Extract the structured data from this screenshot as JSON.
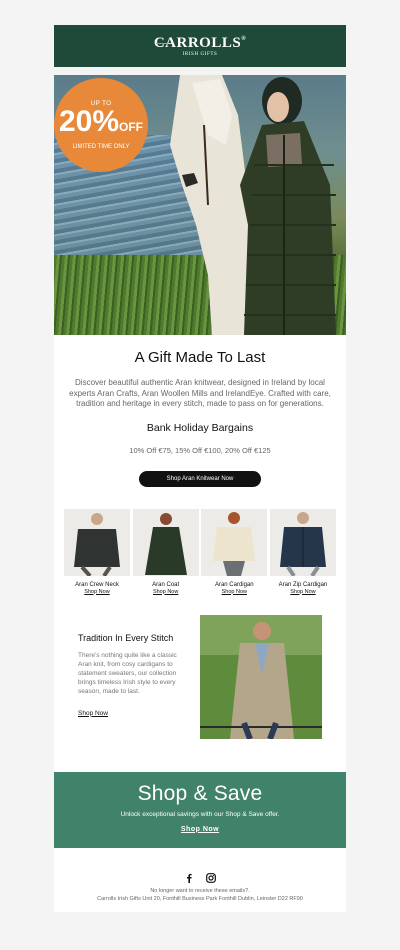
{
  "header": {
    "logo_main": "CARROLLS",
    "logo_reg": "®",
    "logo_sub": "IRISH GIFTS",
    "bg_color": "#1f4a3a"
  },
  "hero": {
    "badge_top": "UP TO",
    "badge_percent": "20%",
    "badge_off": "OFF",
    "badge_bottom": "LIMITED TIME ONLY",
    "badge_color": "#e8893a"
  },
  "intro": {
    "title": "A Gift Made To Last",
    "body": "Discover beautiful authentic Aran knitwear, designed in Ireland by local experts Aran Crafts, Aran Woollen Mills and IrelandEye. Crafted with care, tradition and heritage in every stitch, made to pass on for generations.",
    "subtitle": "Bank Holiday Bargains",
    "offers": "10% Off €75, 15% Off €100, 20% Off €125",
    "button_label": "Shop Aran Knitwear Now"
  },
  "products": [
    {
      "name": "Aran Crew Neck",
      "link": "Shop Now"
    },
    {
      "name": "Aran Coat",
      "link": "Shop Now"
    },
    {
      "name": "Aran Cardigan",
      "link": "Shop Now"
    },
    {
      "name": "Aran Zip Cardigan",
      "link": "Shop Now"
    }
  ],
  "tradition": {
    "title": "Tradition In Every Stitch",
    "body": "There's nothing quite like a classic Aran knit, from cosy cardigans to statement sweaters, our collection brings timeless Irish style to every season, made to last.",
    "link": "Shop Now"
  },
  "promo": {
    "title": "Shop & Save",
    "subtitle": "Unlock exceptional savings with our Shop & Save offer.",
    "link": "Shop Now",
    "bg_color": "#41836a"
  },
  "footer": {
    "social_icons": [
      "facebook-icon",
      "instagram-icon"
    ],
    "unsubscribe": "No longer want to receive these emails?.",
    "address": "Carrolls Irish Gifts Unit 20, Fonthill Business Park Fonthill Dublin, Leinster D22 RF90"
  }
}
